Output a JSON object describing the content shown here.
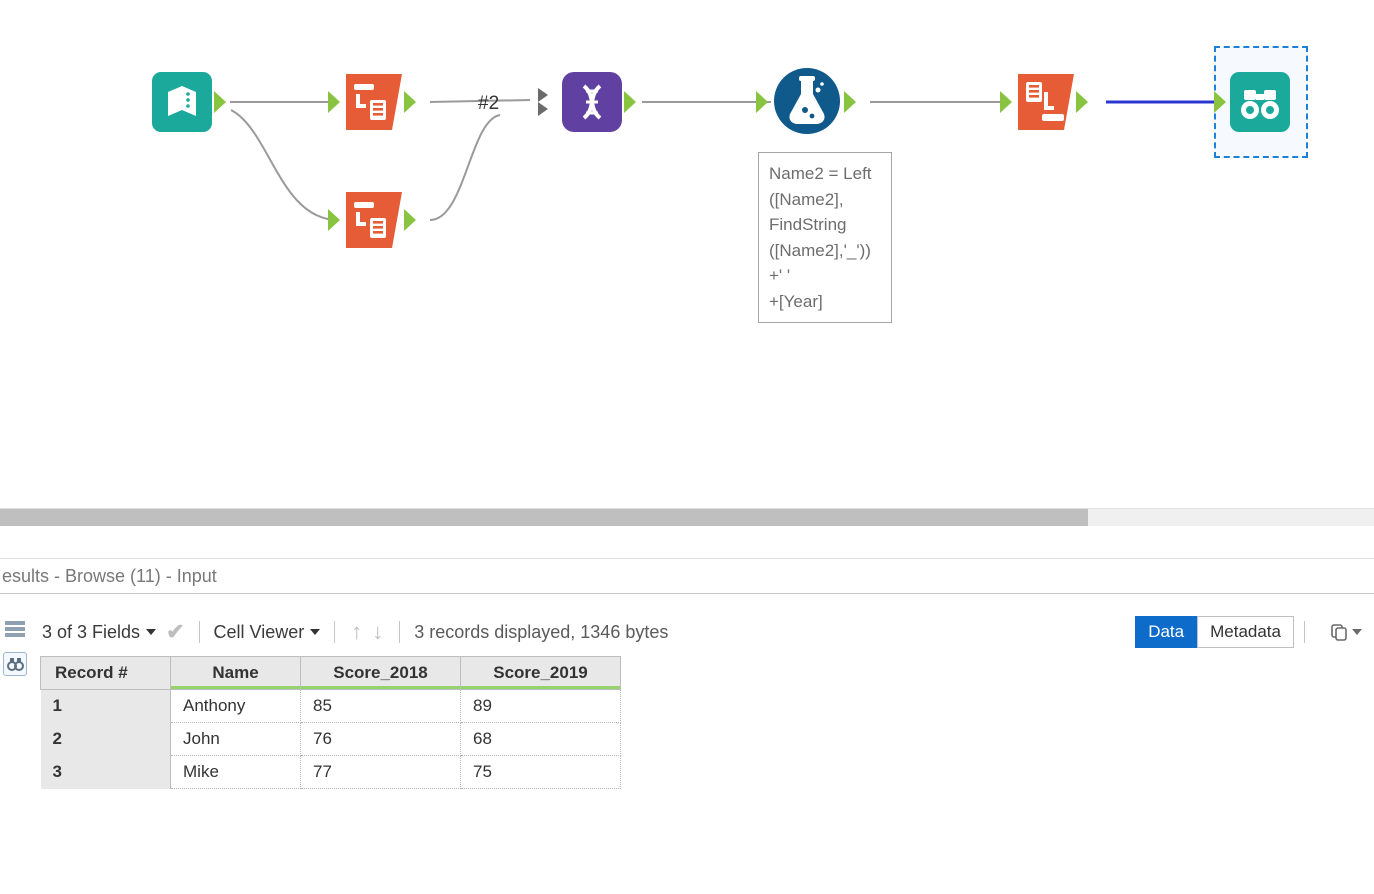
{
  "canvas": {
    "join_label": "#2",
    "annotation_text": "Name2 = Left\n([Name2],\nFindString\n([Name2],'_'))\n+' '\n+[Year]",
    "tool_names": {
      "input": "text-input-tool",
      "transpose1": "transpose-tool",
      "transpose2": "transpose-tool",
      "join": "join-tool",
      "formula": "formula-tool",
      "crosstab": "crosstab-tool",
      "browse": "browse-tool"
    }
  },
  "results": {
    "panel_title": "esults - Browse (11) - Input",
    "fields_label": "3 of 3 Fields",
    "cell_viewer_label": "Cell Viewer",
    "status_text": "3 records displayed, 1346 bytes",
    "tab_data": "Data",
    "tab_metadata": "Metadata",
    "columns": [
      "Record #",
      "Name",
      "Score_2018",
      "Score_2019"
    ],
    "rows": [
      {
        "n": "1",
        "Name": "Anthony",
        "Score_2018": "85",
        "Score_2019": "89"
      },
      {
        "n": "2",
        "Name": "John",
        "Score_2018": "76",
        "Score_2019": "68"
      },
      {
        "n": "3",
        "Name": "Mike",
        "Score_2018": "77",
        "Score_2019": "75"
      }
    ]
  }
}
